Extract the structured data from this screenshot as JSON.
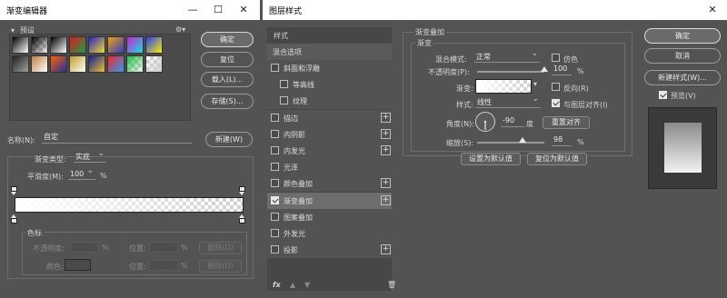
{
  "gradient_editor": {
    "title": "渐变编辑器",
    "presets_label": "预设",
    "buttons": {
      "ok": "确定",
      "reset": "复位",
      "load": "载入(L)...",
      "save": "存储(S)...",
      "new": "新建(W)"
    },
    "name_label": "名称(N):",
    "name_value": "自定",
    "type_label": "渐变类型:",
    "type_value": "实底",
    "smoothness_label": "平滑度(M):",
    "smoothness_value": "100",
    "smoothness_unit": "%",
    "color_stops_label": "色标",
    "opacity_label": "不透明度:",
    "opacity_unit": "%",
    "position_label": "位置:",
    "position_unit": "%",
    "delete_label": "删除(D)",
    "color_label": "颜色:",
    "presets": [
      [
        "#000000",
        "#ffffff"
      ],
      [
        "#000000",
        "transparent"
      ],
      [
        "#000000",
        "#ffffff"
      ],
      [
        "#e01818",
        "#18a048"
      ],
      [
        "#2a1fd0",
        "#f0e020"
      ],
      [
        "#f0a000",
        "#2a40d0"
      ],
      [
        "#d020d0",
        "#10e0e0"
      ],
      [
        "#2040ff",
        "#ffee00"
      ],
      [
        "#202020",
        "#a0a0a0"
      ],
      [
        "#c08040",
        "#ffffff"
      ],
      [
        "#ff6000",
        "#2030a0"
      ],
      [
        "#c0a020",
        "#ffffff"
      ],
      [
        "#1020a0",
        "#f0c020"
      ],
      [
        "#ff2020",
        "#20a0ff"
      ],
      [
        "#20c040",
        "transparent"
      ],
      [
        "transparent",
        "#cfcfcf"
      ]
    ]
  },
  "layer_style": {
    "title": "图层样式",
    "sidebar": {
      "header": "样式",
      "blend_options": "混合选项",
      "items": [
        {
          "label": "斜面和浮雕",
          "checked": false,
          "indent": false,
          "plus": false
        },
        {
          "label": "等高线",
          "checked": false,
          "indent": true,
          "plus": false
        },
        {
          "label": "纹理",
          "checked": false,
          "indent": true,
          "plus": false
        },
        {
          "label": "描边",
          "checked": false,
          "indent": false,
          "plus": true
        },
        {
          "label": "内阴影",
          "checked": false,
          "indent": false,
          "plus": true
        },
        {
          "label": "内发光",
          "checked": false,
          "indent": false,
          "plus": true
        },
        {
          "label": "光泽",
          "checked": false,
          "indent": false,
          "plus": false
        },
        {
          "label": "颜色叠加",
          "checked": false,
          "indent": false,
          "plus": true
        },
        {
          "label": "渐变叠加",
          "checked": true,
          "indent": false,
          "plus": true,
          "selected": true
        },
        {
          "label": "图案叠加",
          "checked": false,
          "indent": false,
          "plus": false
        },
        {
          "label": "外发光",
          "checked": false,
          "indent": false,
          "plus": false
        },
        {
          "label": "投影",
          "checked": false,
          "indent": false,
          "plus": true
        }
      ],
      "fx_label": "fx"
    },
    "section_title": "渐变叠加",
    "group_title": "渐变",
    "blend_mode_label": "混合模式:",
    "blend_mode_value": "正常",
    "dither_label": "仿色",
    "opacity_label": "不透明度(P):",
    "opacity_value": "100",
    "opacity_fraction": 1.0,
    "opacity_unit": "%",
    "gradient_label": "渐变:",
    "reverse_label": "反向(R)",
    "style_label": "样式:",
    "style_value": "线性",
    "align_label": "与图层对齐(I)",
    "angle_label": "角度(N):",
    "angle_value": "-90",
    "angle_unit": "度",
    "reset_align_label": "重置对齐",
    "scale_label": "缩放(S):",
    "scale_value": "98",
    "scale_fraction": 0.27,
    "scale_unit": "%",
    "set_default_label": "设置为默认值",
    "reset_default_label": "复位为默认值",
    "buttons": {
      "ok": "确定",
      "cancel": "取消",
      "new_style": "新建样式(W)..."
    },
    "preview_label": "预览(V)"
  }
}
